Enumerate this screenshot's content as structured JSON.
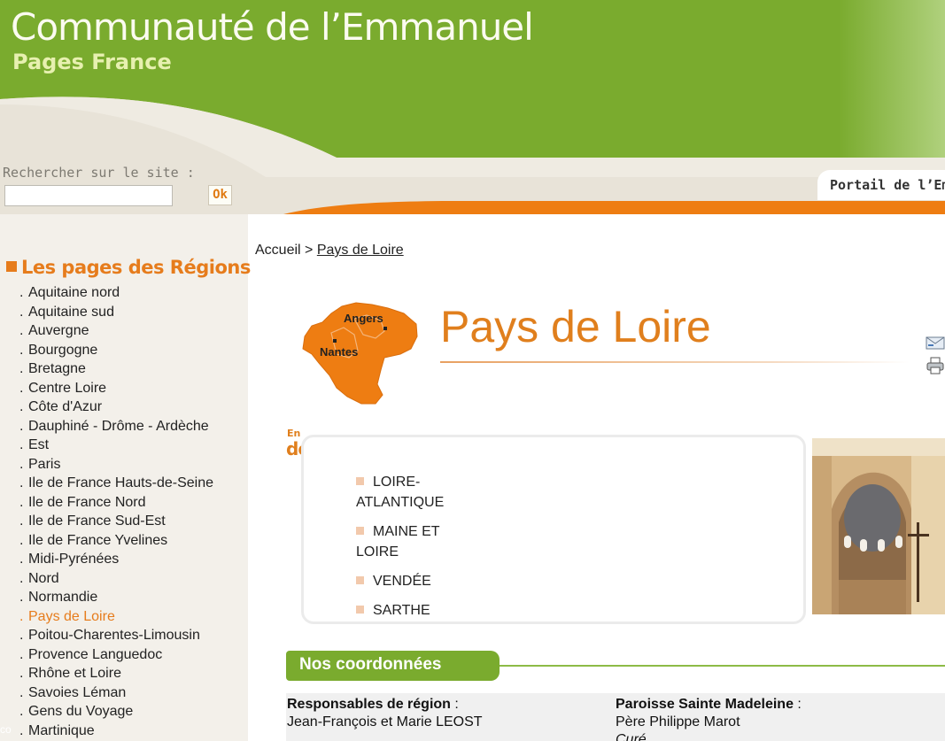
{
  "header": {
    "title": "Communauté de l’Emmanuel",
    "subtitle": "Pages France"
  },
  "search": {
    "label": "Rechercher sur le site :",
    "value": "",
    "button": "Ok"
  },
  "portal_tab": "Portail de l’Emmar",
  "sidebar": {
    "title": "Les pages des Régions",
    "items": [
      {
        "label": "Aquitaine nord"
      },
      {
        "label": "Aquitaine sud"
      },
      {
        "label": "Auvergne"
      },
      {
        "label": "Bourgogne"
      },
      {
        "label": "Bretagne"
      },
      {
        "label": "Centre Loire"
      },
      {
        "label": "Côte d'Azur"
      },
      {
        "label": "Dauphiné - Drôme - Ardèche"
      },
      {
        "label": "Est"
      },
      {
        "label": "Paris"
      },
      {
        "label": "Ile de France Hauts-de-Seine"
      },
      {
        "label": "Ile de France Nord"
      },
      {
        "label": "Ile de France Sud-Est"
      },
      {
        "label": "Ile de France Yvelines"
      },
      {
        "label": "Midi-Pyrénées"
      },
      {
        "label": "Nord"
      },
      {
        "label": "Normandie"
      },
      {
        "label": "Pays de Loire",
        "active": true
      },
      {
        "label": "Poitou-Charentes-Limousin"
      },
      {
        "label": "Provence Languedoc"
      },
      {
        "label": "Rhône et Loire"
      },
      {
        "label": "Savoies Léman"
      },
      {
        "label": "Gens du Voyage"
      },
      {
        "label": "Martinique"
      }
    ],
    "corner": "co"
  },
  "breadcrumb": {
    "home": "Accueil",
    "separator": ">",
    "current": "Pays de Loire"
  },
  "map": {
    "city1": "Angers",
    "city2": "Nantes"
  },
  "page": {
    "heading": "Pays de Loire"
  },
  "detail": {
    "label_small": "En",
    "label_big": "détail",
    "departments": [
      "LOIRE-ATLANTIQUE",
      "MAINE ET LOIRE",
      "VENDÉE",
      "SARTHE"
    ]
  },
  "coordonnees": {
    "title": "Nos coordonnées",
    "left_label": "Responsables de région",
    "left_colon": " :",
    "left_value": "Jean-François et Marie LEOST",
    "right_label": "Paroisse Sainte Madeleine",
    "right_colon": " :",
    "right_value": "Père Philippe Marot",
    "right_role": "Curé"
  },
  "colors": {
    "header_green": "#7aab2e",
    "accent_orange": "#e07f1d",
    "sidebar_bg": "#f3f0ea"
  }
}
